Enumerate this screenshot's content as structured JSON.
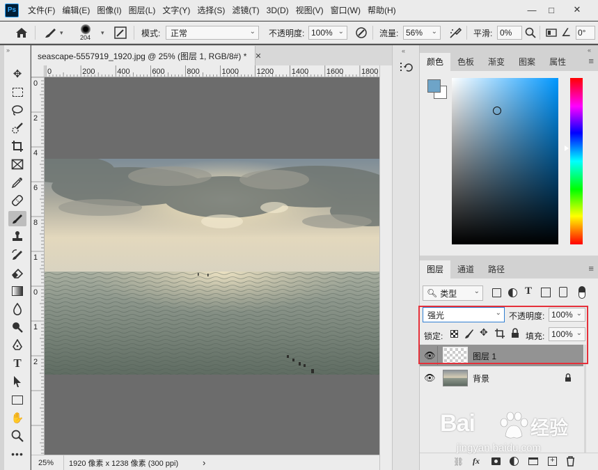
{
  "app": {
    "logo": "Ps"
  },
  "menu": [
    "文件(F)",
    "编辑(E)",
    "图像(I)",
    "图层(L)",
    "文字(Y)",
    "选择(S)",
    "滤镜(T)",
    "3D(D)",
    "视图(V)",
    "窗口(W)",
    "帮助(H)"
  ],
  "window_controls": {
    "minimize": "—",
    "maximize": "□",
    "close": "✕"
  },
  "options_bar": {
    "brush_size": "204",
    "mode_label": "模式:",
    "mode_value": "正常",
    "opacity_label": "不透明度:",
    "opacity_value": "100%",
    "flow_label": "流量:",
    "flow_value": "56%",
    "smoothing_label": "平滑:",
    "smoothing_value": "0%",
    "angle_value": "0°"
  },
  "document": {
    "tab_title": "seascape-5557919_1920.jpg @ 25% (图层 1, RGB/8#) *",
    "close_icon": "✕",
    "ruler_h_labels": [
      "0",
      "200",
      "400",
      "600",
      "800",
      "1000",
      "1200",
      "1400",
      "1600",
      "1800"
    ],
    "ruler_v_labels": [
      "0",
      "2",
      "4",
      "6",
      "8",
      "1",
      "0",
      "1",
      "2"
    ],
    "status_zoom": "25%",
    "status_info": "1920 像素 x 1238 像素 (300 ppi)",
    "status_arrow": "›"
  },
  "color_panel": {
    "tabs": [
      "颜色",
      "色板",
      "渐变",
      "图案",
      "属性"
    ],
    "active_tab": "颜色",
    "foreground": "#6ea4c8",
    "background": "#ffffff",
    "hue_color": "#0097ff"
  },
  "layers_panel": {
    "tabs": [
      "图层",
      "通道",
      "路径"
    ],
    "active_tab": "图层",
    "filter_label": "类型",
    "blend_mode": "强光",
    "opacity_label": "不透明度:",
    "opacity_value": "100%",
    "lock_label": "锁定:",
    "fill_label": "填充:",
    "fill_value": "100%",
    "layers": [
      {
        "name": "图层 1",
        "selected": true
      },
      {
        "name": "背景",
        "selected": false
      }
    ]
  },
  "watermark": {
    "brand": "Bai",
    "brand2": "经验",
    "url": "jingyan.baidu.com"
  },
  "colors": {
    "highlight": "#e5303a",
    "accent": "#31a8ff"
  }
}
